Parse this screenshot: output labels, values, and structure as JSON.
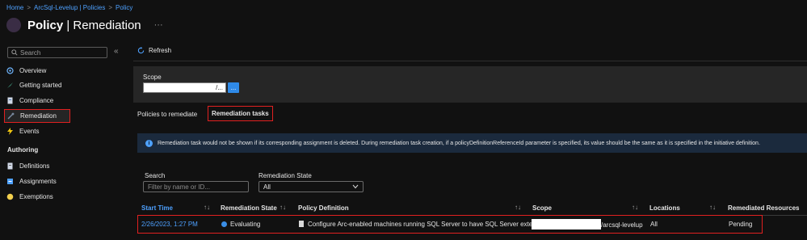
{
  "breadcrumb": [
    "Home",
    "ArcSql-Levelup | Policies",
    "Policy"
  ],
  "header": {
    "title_bold": "Policy",
    "title_rest": "| Remediation",
    "more": "···"
  },
  "sidebar": {
    "search_placeholder": "Search",
    "collapse": "«",
    "items": [
      {
        "label": "Overview",
        "icon": "overview-icon"
      },
      {
        "label": "Getting started",
        "icon": "rocket-icon"
      },
      {
        "label": "Compliance",
        "icon": "compliance-icon"
      },
      {
        "label": "Remediation",
        "icon": "remediation-icon",
        "selected": true
      },
      {
        "label": "Events",
        "icon": "lightning-icon"
      }
    ],
    "section_authoring": "Authoring",
    "authoring_items": [
      {
        "label": "Definitions",
        "icon": "definitions-icon"
      },
      {
        "label": "Assignments",
        "icon": "assignments-icon"
      },
      {
        "label": "Exemptions",
        "icon": "exemptions-icon"
      }
    ]
  },
  "toolbar": {
    "refresh_label": "Refresh"
  },
  "scope": {
    "label": "Scope",
    "value": "/...",
    "button": "..."
  },
  "tabs": [
    {
      "label": "Policies to remediate",
      "active": false
    },
    {
      "label": "Remediation tasks",
      "active": true
    }
  ],
  "info_banner": "Remediation task would not be shown if its corresponding assignment is deleted. During remediation task creation, if a policyDefinitionReferenceId parameter is specified, its value should be the same as it is specified in the initiative definition.",
  "filters": {
    "search_label": "Search",
    "search_placeholder": "Filter by name or ID...",
    "state_label": "Remediation State",
    "state_value": "All"
  },
  "table": {
    "columns": [
      "Start Time",
      "Remediation State",
      "Policy Definition",
      "Scope",
      "Locations",
      "Remediated Resources"
    ],
    "rows": [
      {
        "start_time": "2/26/2023, 1:27 PM",
        "state": "Evaluating",
        "policy_definition": "Configure Arc-enabled machines running SQL Server to have SQL Server exten...",
        "scope": "/arcsql-levelup",
        "locations": "All",
        "remediated_resources": "Pending"
      }
    ]
  },
  "colors": {
    "accent": "#4ea1ff",
    "highlight": "#e02020",
    "background": "#111111",
    "info_bg": "#1b2a3d"
  }
}
